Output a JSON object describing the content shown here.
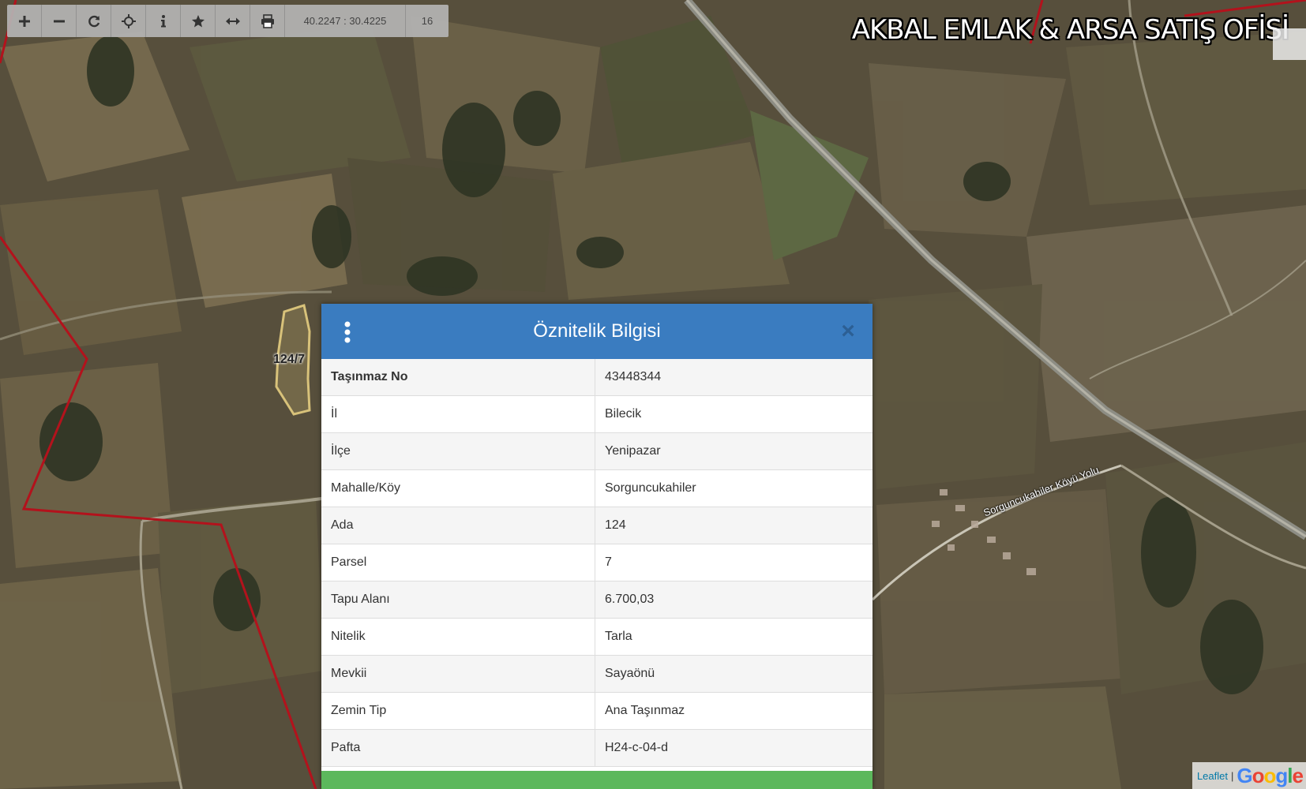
{
  "toolbar": {
    "coordinates": "40.2247 : 30.4225",
    "zoom_level": "16",
    "tools": [
      "zoom-in",
      "zoom-out",
      "refresh",
      "locate",
      "info",
      "favorite",
      "measure",
      "print"
    ]
  },
  "watermark": "AKBAL EMLAK & ARSA SATIŞ OFİSİ",
  "map": {
    "parcel_label": "124/7",
    "road_label": "Sorguncukahiler Köyü Yolu"
  },
  "panel": {
    "title": "Öznitelik Bilgisi",
    "rows": [
      {
        "key": "Taşınmaz No",
        "value": "43448344"
      },
      {
        "key": "İl",
        "value": "Bilecik"
      },
      {
        "key": "İlçe",
        "value": "Yenipazar"
      },
      {
        "key": "Mahalle/Köy",
        "value": "Sorguncukahiler"
      },
      {
        "key": "Ada",
        "value": "124"
      },
      {
        "key": "Parsel",
        "value": "7"
      },
      {
        "key": "Tapu Alanı",
        "value": "6.700,03"
      },
      {
        "key": "Nitelik",
        "value": "Tarla"
      },
      {
        "key": "Mevkii",
        "value": "Sayaönü"
      },
      {
        "key": "Zemin Tip",
        "value": "Ana Taşınmaz"
      },
      {
        "key": "Pafta",
        "value": "H24-c-04-d"
      }
    ]
  },
  "attribution": {
    "leaflet": "Leaflet",
    "separator": "|",
    "provider": "Google"
  },
  "colors": {
    "header": "#3a7cc0",
    "footer": "#5cb85c",
    "boundary": "#b3121c",
    "parcel_outline": "#d8c27a"
  }
}
